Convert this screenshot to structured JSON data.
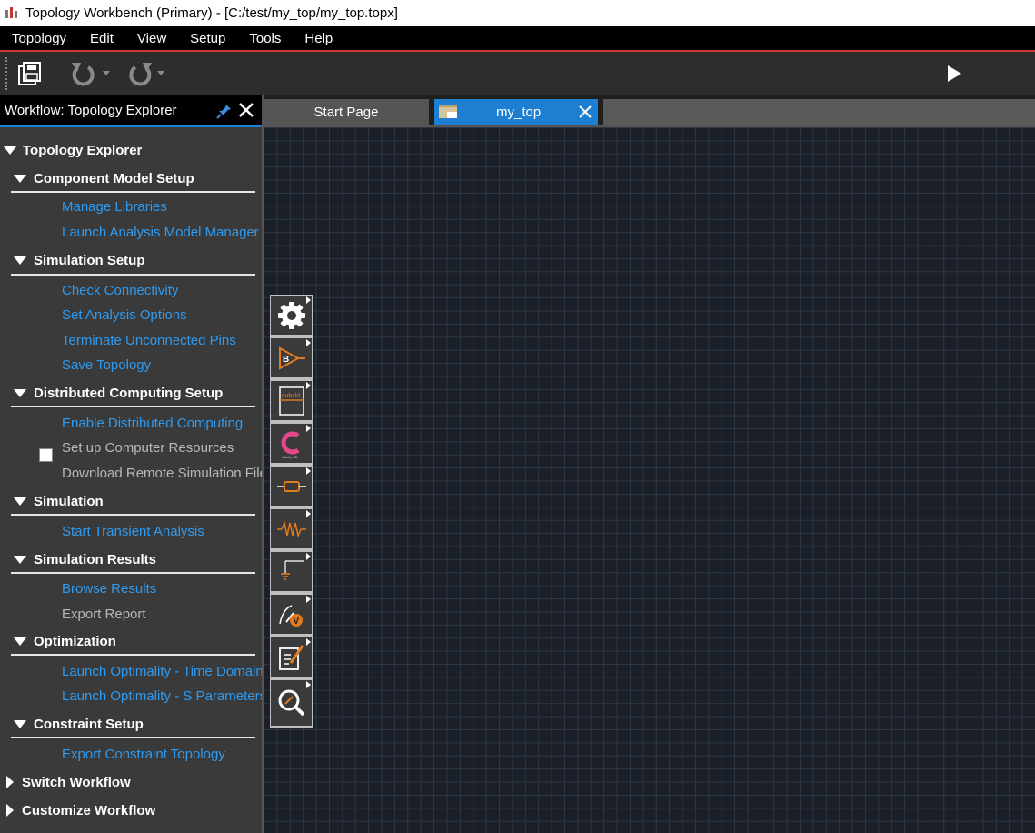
{
  "window": {
    "title": "Topology Workbench (Primary) - [C:/test/my_top/my_top.topx]"
  },
  "menu": [
    "Topology",
    "Edit",
    "View",
    "Setup",
    "Tools",
    "Help"
  ],
  "toolbar": {
    "buttons": [
      "save-icon",
      "undo-icon",
      "redo-icon",
      "run-icon"
    ]
  },
  "panel": {
    "title": "Workflow: Topology Explorer",
    "root": "Topology Explorer",
    "sections": [
      {
        "label": "Component Model Setup",
        "items": [
          "Manage Libraries",
          "Launch Analysis Model Manager"
        ]
      },
      {
        "label": "Simulation Setup",
        "items": [
          "Check Connectivity",
          "Set Analysis Options",
          "Terminate Unconnected Pins",
          "Save Topology"
        ]
      },
      {
        "label": "Distributed Computing Setup",
        "items": [
          "Enable Distributed Computing",
          "Set up Computer Resources",
          "Download Remote Simulation File"
        ]
      },
      {
        "label": "Simulation",
        "items": [
          "Start Transient Analysis"
        ]
      },
      {
        "label": "Simulation Results",
        "items": [
          "Browse Results",
          "Export Report"
        ]
      },
      {
        "label": "Optimization",
        "items": [
          "Launch Optimality - Time Domain",
          "Launch Optimality - S Parameters"
        ]
      },
      {
        "label": "Constraint Setup",
        "items": [
          "Export Constraint Topology"
        ]
      }
    ],
    "collapsed": [
      "Switch Workflow",
      "Customize Workflow"
    ]
  },
  "tabs": [
    {
      "label": "Start Page",
      "active": false
    },
    {
      "label": "my_top",
      "active": true
    }
  ],
  "palette": {
    "tools": [
      "gear-icon",
      "buffer-icon",
      "subckt-icon",
      "clarity3d-icon",
      "resistor-icon",
      "source-icon",
      "ground-icon",
      "probe-icon",
      "notes-icon",
      "zoom-icon"
    ],
    "subckt_label": "subckt",
    "clarity_label": "Clarity 3D"
  },
  "colors": {
    "accent": "#1e7fd2",
    "link": "#2f9bf0",
    "menu_border": "#d23a3a",
    "canvas": "#1b1f28"
  }
}
